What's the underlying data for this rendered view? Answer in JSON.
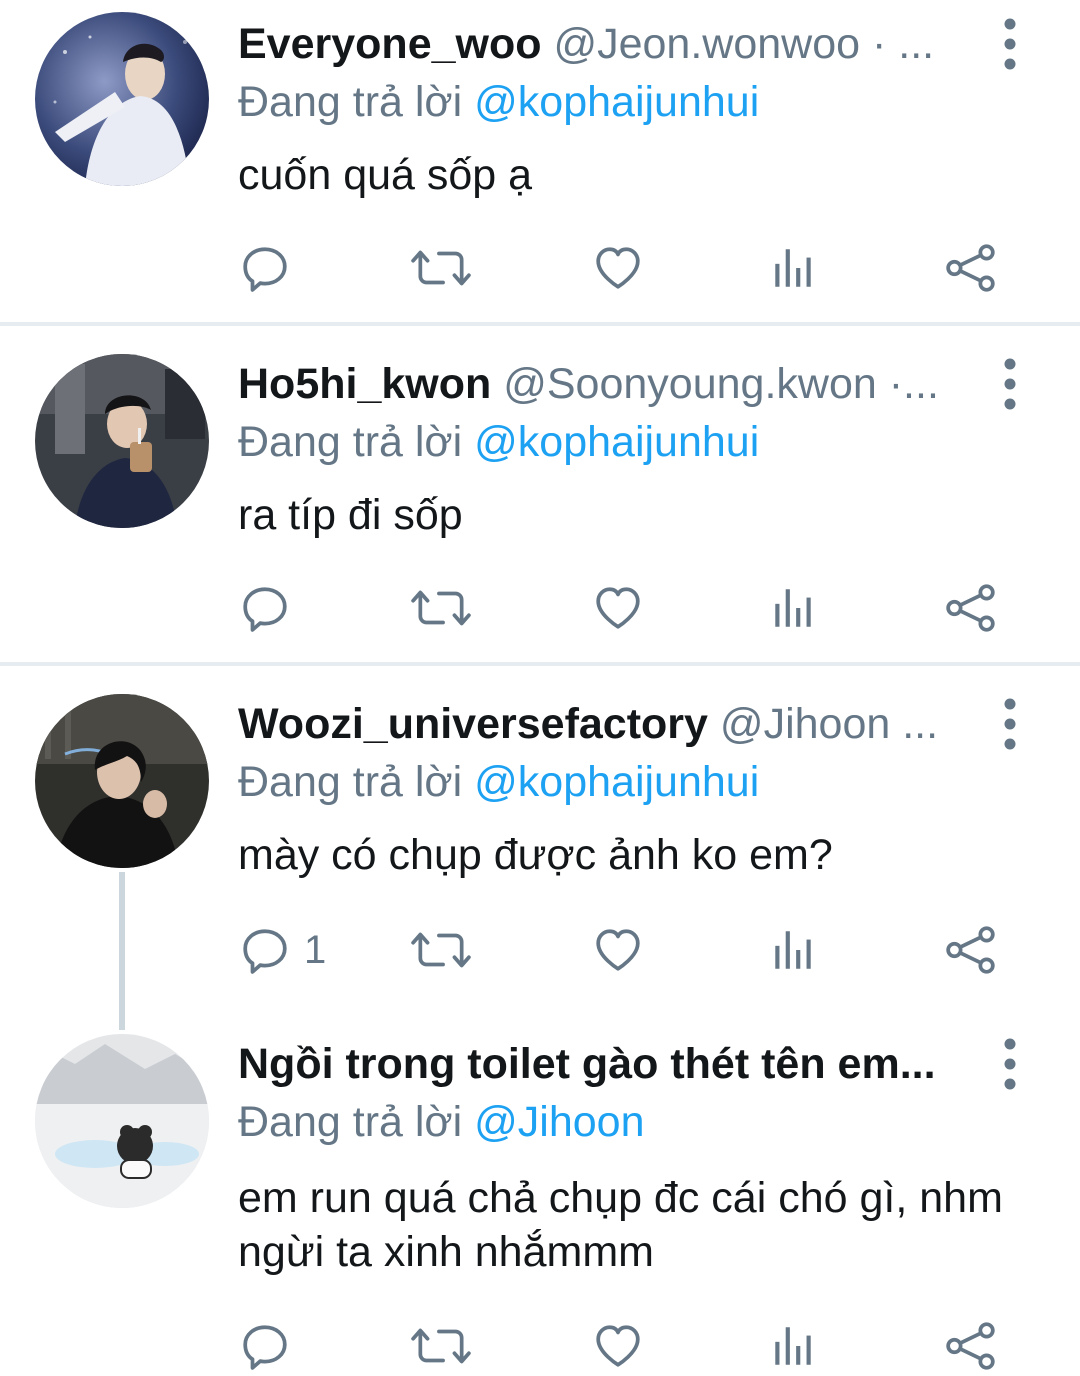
{
  "tweets": [
    {
      "name": "Everyone_woo",
      "handle": "@Jeon.wonwoo · ...",
      "replying_prefix": "Đang trả lời",
      "replying_to": "@kophaijunhui",
      "text": "cuốn quá sốp ạ",
      "reply_count": ""
    },
    {
      "name": "Ho5hi_kwon",
      "handle": "@Soonyoung.kwon ·...",
      "replying_prefix": "Đang trả lời",
      "replying_to": "@kophaijunhui",
      "text": "ra típ đi sốp",
      "reply_count": ""
    },
    {
      "name": "Woozi_universefactory",
      "handle": "@Jihoon ...",
      "replying_prefix": "Đang trả lời",
      "replying_to": "@kophaijunhui",
      "text": "mày có chụp được ảnh ko em?",
      "reply_count": "1"
    },
    {
      "name": "Ngồi trong toilet gào thét tên em...",
      "handle": "",
      "replying_prefix": "Đang trả lời",
      "replying_to": "@Jihoon",
      "text": "em run quá chả chụp đc cái chó gì, nhm ngừi ta xinh nhắmmm",
      "reply_count": ""
    }
  ],
  "icons": {
    "reply": "reply-icon",
    "retweet": "retweet-icon",
    "like": "heart-icon",
    "analytics": "analytics-icon",
    "share": "share-icon",
    "more": "more-vertical-icon"
  },
  "colors": {
    "text_primary": "#14171a",
    "text_secondary": "#657786",
    "mention": "#1da1f2",
    "divider": "#e6ecf0",
    "thread_line": "#ccd6dd"
  }
}
